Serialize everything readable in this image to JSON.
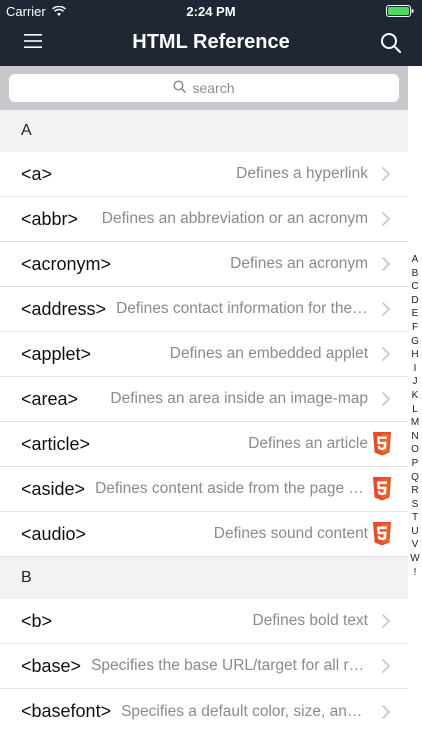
{
  "status": {
    "carrier": "Carrier",
    "time": "2:24 PM"
  },
  "nav": {
    "title": "HTML Reference"
  },
  "search": {
    "placeholder": "search"
  },
  "sections": [
    {
      "letter": "A",
      "rows": [
        {
          "tag": "<a>",
          "desc": "Defines a hyperlink",
          "accessory": "chevron"
        },
        {
          "tag": "<abbr>",
          "desc": "Defines an abbreviation or an acronym",
          "accessory": "chevron"
        },
        {
          "tag": "<acronym>",
          "desc": "Defines an acronym",
          "accessory": "chevron"
        },
        {
          "tag": "<address>",
          "desc": "Defines contact information for the author",
          "accessory": "chevron"
        },
        {
          "tag": "<applet>",
          "desc": "Defines an embedded applet",
          "accessory": "chevron"
        },
        {
          "tag": "<area>",
          "desc": "Defines an area inside an image-map",
          "accessory": "chevron"
        },
        {
          "tag": "<article>",
          "desc": "Defines an article",
          "accessory": "html5-icon"
        },
        {
          "tag": "<aside>",
          "desc": "Defines content aside from the page content",
          "accessory": "html5-icon"
        },
        {
          "tag": "<audio>",
          "desc": "Defines sound content",
          "accessory": "html5-icon"
        }
      ]
    },
    {
      "letter": "B",
      "rows": [
        {
          "tag": "<b>",
          "desc": "Defines bold text",
          "accessory": "chevron"
        },
        {
          "tag": "<base>",
          "desc": "Specifies the base URL/target for all relative URLs",
          "accessory": "chevron"
        },
        {
          "tag": "<basefont>",
          "desc": "Specifies a default color, size, and font",
          "accessory": "chevron"
        }
      ]
    }
  ],
  "index": [
    "A",
    "B",
    "C",
    "D",
    "E",
    "F",
    "G",
    "H",
    "I",
    "J",
    "K",
    "L",
    "M",
    "N",
    "O",
    "P",
    "Q",
    "R",
    "S",
    "T",
    "U",
    "V",
    "W",
    "!"
  ],
  "colors": {
    "navbar": "#1f2735",
    "search_bg": "#c8c8cc",
    "html5": "#e44d26",
    "battery": "#4cd964"
  }
}
